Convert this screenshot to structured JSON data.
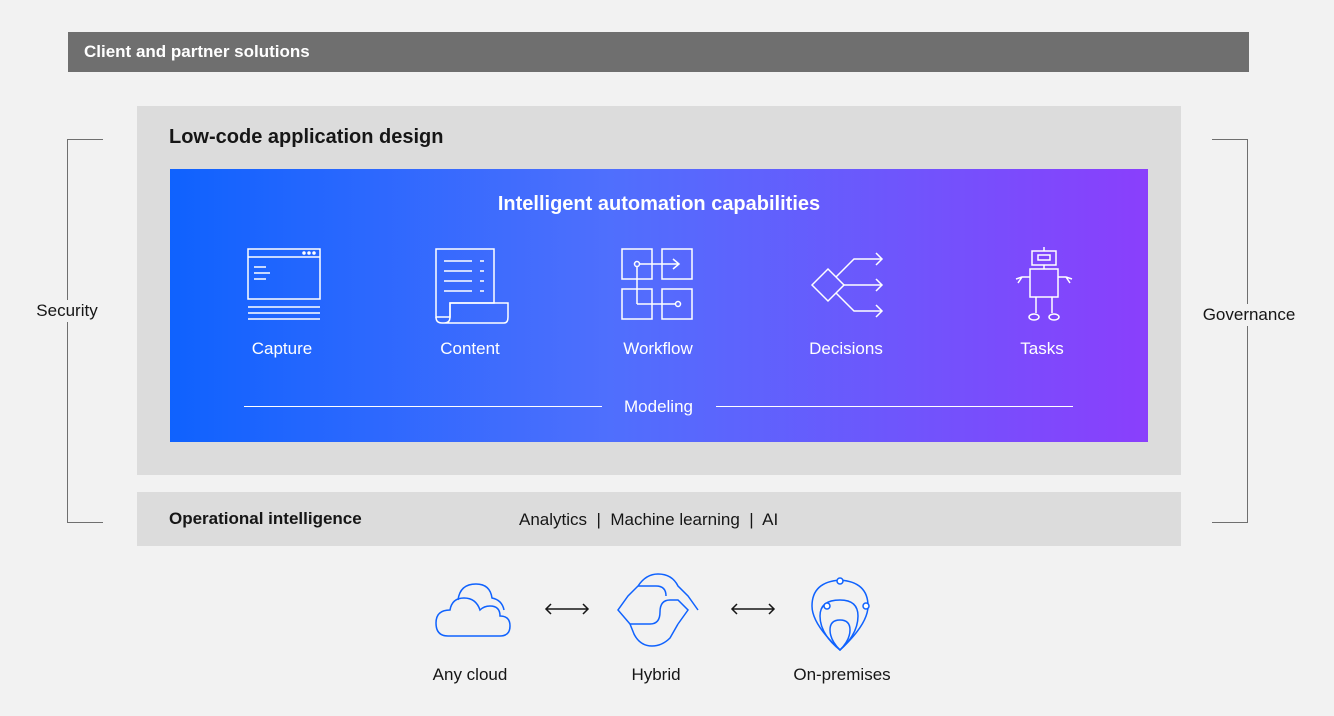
{
  "banner": {
    "label": "Client and partner solutions"
  },
  "low_code": {
    "title": "Low-code application design"
  },
  "capabilities": {
    "title": "Intelligent automation capabilities",
    "items": [
      {
        "label": "Capture",
        "icon": "window-form-icon"
      },
      {
        "label": "Content",
        "icon": "document-scroll-icon"
      },
      {
        "label": "Workflow",
        "icon": "workflow-grid-icon"
      },
      {
        "label": "Decisions",
        "icon": "decision-diamond-icon"
      },
      {
        "label": "Tasks",
        "icon": "robot-icon"
      }
    ],
    "modeling": "Modeling"
  },
  "operational": {
    "title": "Operational intelligence",
    "items": "Analytics  |  Machine learning  |  AI"
  },
  "sides": {
    "left": "Security",
    "right": "Governance"
  },
  "deployment": [
    {
      "label": "Any cloud",
      "icon": "cloud-icon"
    },
    {
      "label": "Hybrid",
      "icon": "hybrid-icon"
    },
    {
      "label": "On-premises",
      "icon": "location-pin-icon"
    }
  ],
  "colors": {
    "banner": "#6f6f6f",
    "panel": "#dcdcdc",
    "gradient_start": "#0f62fe",
    "gradient_end": "#8a3ffc",
    "icon_blue": "#0f62fe"
  }
}
